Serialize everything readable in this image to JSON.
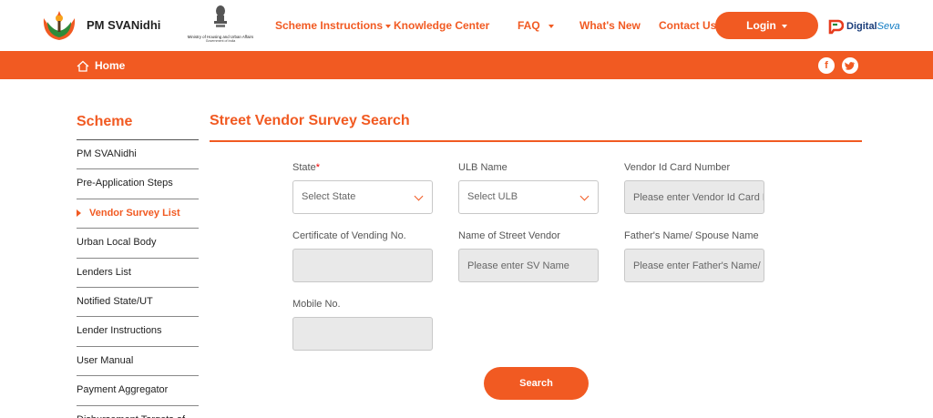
{
  "header": {
    "brand_name": "PM SVANidhi",
    "ministry_line1": "Ministry of Housing and Urban Affairs",
    "ministry_line2": "Government of India",
    "nav": {
      "scheme_instructions": "Scheme Instructions",
      "knowledge_center": "Knowledge Center",
      "faq": "FAQ",
      "whats_new": "What's New",
      "contact_us": "Contact Us"
    },
    "login_label": "Login",
    "partner_name_main": "Digital",
    "partner_name_accent": "Seva"
  },
  "breadcrumb": {
    "home_label": "Home",
    "social": {
      "facebook": "f",
      "twitter": "t"
    }
  },
  "sidebar": {
    "title": "Scheme",
    "items": [
      {
        "label": "PM SVANidhi"
      },
      {
        "label": "Pre-Application Steps"
      },
      {
        "label": "Vendor Survey List"
      },
      {
        "label": "Urban Local Body"
      },
      {
        "label": "Lenders List"
      },
      {
        "label": "Notified State/UT"
      },
      {
        "label": "Lender Instructions"
      },
      {
        "label": "User Manual"
      },
      {
        "label": "Payment Aggregator"
      },
      {
        "label": "Disbursement Targets of"
      }
    ],
    "active_item": "Vendor Survey List"
  },
  "main": {
    "title": "Street Vendor Survey Search",
    "form": {
      "state": {
        "label": "State",
        "required_mark": "*",
        "selected": "Select State"
      },
      "ulb": {
        "label": "ULB Name",
        "selected": "Select ULB"
      },
      "vendor_id": {
        "label": "Vendor Id Card Number",
        "placeholder": "Please enter Vendor Id Card Number"
      },
      "certificate": {
        "label": "Certificate of Vending No.",
        "value": ""
      },
      "vendor_name": {
        "label": "Name of Street Vendor",
        "placeholder": "Please enter SV Name"
      },
      "father_name": {
        "label": "Father's Name/ Spouse Name",
        "placeholder": "Please enter Father's Name/ Spouse Name"
      },
      "mobile": {
        "label": "Mobile No.",
        "value": ""
      },
      "search_label": "Search"
    }
  },
  "colors": {
    "accent": "#f15a22",
    "field_disabled": "#e9e9e9"
  }
}
